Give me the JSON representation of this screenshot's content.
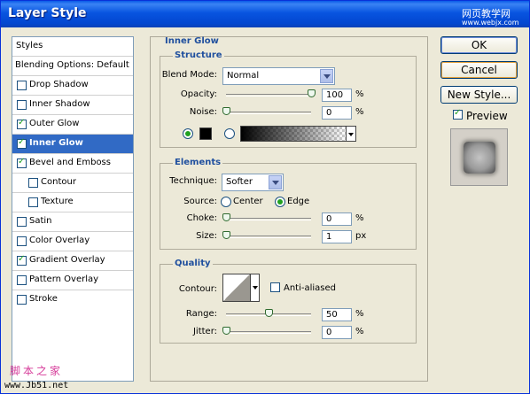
{
  "window": {
    "title": "Layer Style",
    "watermark_top": "网页教学网",
    "watermark_url": "www.webjx.com"
  },
  "left": {
    "styles_label": "Styles",
    "blending_label": "Blending Options: Default",
    "items": [
      {
        "label": "Drop Shadow",
        "checked": false
      },
      {
        "label": "Inner Shadow",
        "checked": false
      },
      {
        "label": "Outer Glow",
        "checked": true
      },
      {
        "label": "Inner Glow",
        "checked": true,
        "selected": true
      },
      {
        "label": "Bevel and Emboss",
        "checked": true
      },
      {
        "label": "Contour",
        "checked": false,
        "indent": true
      },
      {
        "label": "Texture",
        "checked": false,
        "indent": true
      },
      {
        "label": "Satin",
        "checked": false
      },
      {
        "label": "Color Overlay",
        "checked": false
      },
      {
        "label": "Gradient Overlay",
        "checked": true
      },
      {
        "label": "Pattern Overlay",
        "checked": false
      },
      {
        "label": "Stroke",
        "checked": false
      }
    ]
  },
  "panel": {
    "title": "Inner Glow",
    "structure": {
      "title": "Structure",
      "blend_mode_label": "Blend Mode:",
      "blend_mode_value": "Normal",
      "opacity_label": "Opacity:",
      "opacity_value": "100",
      "opacity_fraction": 1.0,
      "noise_label": "Noise:",
      "noise_value": "0",
      "noise_fraction": 0.0,
      "unit": "%"
    },
    "elements": {
      "title": "Elements",
      "technique_label": "Technique:",
      "technique_value": "Softer",
      "source_label": "Source:",
      "center_label": "Center",
      "edge_label": "Edge",
      "choke_label": "Choke:",
      "choke_value": "0",
      "choke_unit": "%",
      "choke_fraction": 0.0,
      "size_label": "Size:",
      "size_value": "1",
      "size_unit": "px",
      "size_fraction": 0.0
    },
    "quality": {
      "title": "Quality",
      "contour_label": "Contour:",
      "antialiased_label": "Anti-aliased",
      "range_label": "Range:",
      "range_value": "50",
      "range_unit": "%",
      "range_fraction": 0.5,
      "jitter_label": "Jitter:",
      "jitter_value": "0",
      "jitter_unit": "%",
      "jitter_fraction": 0.0
    }
  },
  "buttons": {
    "ok": "OK",
    "cancel": "Cancel",
    "new_style": "New Style...",
    "preview_label": "Preview"
  },
  "footer": {
    "line1": "脚本之家",
    "line2": "www.Jb51.net"
  }
}
